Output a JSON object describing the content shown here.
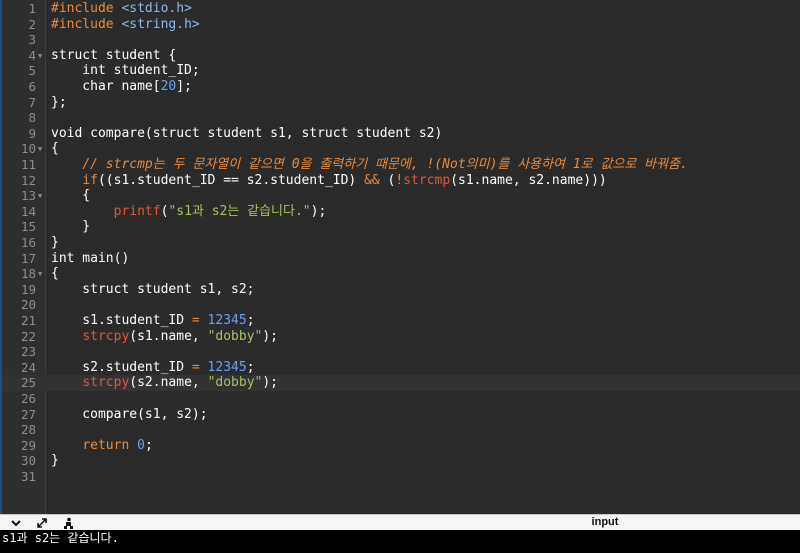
{
  "editor": {
    "active_line": 25,
    "lines": [
      {
        "n": "1",
        "fold": false,
        "segs": [
          {
            "c": "t-pre",
            "t": "#include "
          },
          {
            "c": "t-inc",
            "t": "<stdio.h>"
          }
        ]
      },
      {
        "n": "2",
        "fold": false,
        "segs": [
          {
            "c": "t-pre",
            "t": "#include "
          },
          {
            "c": "t-inc",
            "t": "<string.h>"
          }
        ]
      },
      {
        "n": "3",
        "fold": false,
        "segs": []
      },
      {
        "n": "4",
        "fold": true,
        "segs": [
          {
            "c": "",
            "t": "struct student {"
          }
        ]
      },
      {
        "n": "5",
        "fold": false,
        "segs": [
          {
            "c": "",
            "t": "    int student_ID;"
          }
        ]
      },
      {
        "n": "6",
        "fold": false,
        "segs": [
          {
            "c": "",
            "t": "    char name["
          },
          {
            "c": "t-num",
            "t": "20"
          },
          {
            "c": "",
            "t": "];"
          }
        ]
      },
      {
        "n": "7",
        "fold": false,
        "segs": [
          {
            "c": "",
            "t": "};"
          }
        ]
      },
      {
        "n": "8",
        "fold": false,
        "segs": []
      },
      {
        "n": "9",
        "fold": false,
        "segs": [
          {
            "c": "",
            "t": "void compare(struct student s1, struct student s2)"
          }
        ]
      },
      {
        "n": "10",
        "fold": true,
        "segs": [
          {
            "c": "",
            "t": "{"
          }
        ]
      },
      {
        "n": "11",
        "fold": false,
        "segs": [
          {
            "c": "",
            "t": "    "
          },
          {
            "c": "t-com",
            "t": "// strcmp는 두 문자열이 같으면 0을 출력하기 때문에, !(Not의미)를 사용하여 1로 값으로 바꿔줌."
          }
        ]
      },
      {
        "n": "12",
        "fold": false,
        "segs": [
          {
            "c": "",
            "t": "    "
          },
          {
            "c": "t-kw",
            "t": "if"
          },
          {
            "c": "",
            "t": "((s1.student_ID == s2.student_ID) "
          },
          {
            "c": "t-op",
            "t": "&&"
          },
          {
            "c": "",
            "t": " ("
          },
          {
            "c": "t-op",
            "t": "!"
          },
          {
            "c": "t-fn",
            "t": "strcmp"
          },
          {
            "c": "",
            "t": "(s1.name, s2.name)))"
          }
        ]
      },
      {
        "n": "13",
        "fold": true,
        "segs": [
          {
            "c": "",
            "t": "    {"
          }
        ]
      },
      {
        "n": "14",
        "fold": false,
        "segs": [
          {
            "c": "",
            "t": "        "
          },
          {
            "c": "t-fn",
            "t": "printf"
          },
          {
            "c": "",
            "t": "("
          },
          {
            "c": "t-str",
            "t": "\"s1과 s2는 같습니다.\""
          },
          {
            "c": "",
            "t": ");"
          }
        ]
      },
      {
        "n": "15",
        "fold": false,
        "segs": [
          {
            "c": "",
            "t": "    }"
          }
        ]
      },
      {
        "n": "16",
        "fold": false,
        "segs": [
          {
            "c": "",
            "t": "}"
          }
        ]
      },
      {
        "n": "17",
        "fold": false,
        "segs": [
          {
            "c": "",
            "t": "int main()"
          }
        ]
      },
      {
        "n": "18",
        "fold": true,
        "segs": [
          {
            "c": "",
            "t": "{"
          }
        ]
      },
      {
        "n": "19",
        "fold": false,
        "segs": [
          {
            "c": "",
            "t": "    struct student s1, s2;"
          }
        ]
      },
      {
        "n": "20",
        "fold": false,
        "segs": []
      },
      {
        "n": "21",
        "fold": false,
        "segs": [
          {
            "c": "",
            "t": "    s1.student_ID "
          },
          {
            "c": "t-op",
            "t": "="
          },
          {
            "c": "",
            "t": " "
          },
          {
            "c": "t-num",
            "t": "12345"
          },
          {
            "c": "",
            "t": ";"
          }
        ]
      },
      {
        "n": "22",
        "fold": false,
        "segs": [
          {
            "c": "",
            "t": "    "
          },
          {
            "c": "t-fn",
            "t": "strcpy"
          },
          {
            "c": "",
            "t": "(s1.name, "
          },
          {
            "c": "t-str",
            "t": "\"dobby\""
          },
          {
            "c": "",
            "t": ");"
          }
        ]
      },
      {
        "n": "23",
        "fold": false,
        "segs": []
      },
      {
        "n": "24",
        "fold": false,
        "segs": [
          {
            "c": "",
            "t": "    s2.student_ID "
          },
          {
            "c": "t-op",
            "t": "="
          },
          {
            "c": "",
            "t": " "
          },
          {
            "c": "t-num",
            "t": "12345"
          },
          {
            "c": "",
            "t": ";"
          }
        ]
      },
      {
        "n": "25",
        "fold": false,
        "segs": [
          {
            "c": "",
            "t": "    "
          },
          {
            "c": "t-fn",
            "t": "strcpy"
          },
          {
            "c": "",
            "t": "(s2.name, "
          },
          {
            "c": "t-str",
            "t": "\"dobby\""
          },
          {
            "c": "",
            "t": ");"
          }
        ]
      },
      {
        "n": "26",
        "fold": false,
        "segs": []
      },
      {
        "n": "27",
        "fold": false,
        "segs": [
          {
            "c": "",
            "t": "    compare(s1, s2);"
          }
        ]
      },
      {
        "n": "28",
        "fold": false,
        "segs": []
      },
      {
        "n": "29",
        "fold": false,
        "segs": [
          {
            "c": "",
            "t": "    "
          },
          {
            "c": "t-kw",
            "t": "return"
          },
          {
            "c": "",
            "t": " "
          },
          {
            "c": "t-num",
            "t": "0"
          },
          {
            "c": "",
            "t": ";"
          }
        ]
      },
      {
        "n": "30",
        "fold": false,
        "segs": [
          {
            "c": "",
            "t": "}"
          }
        ]
      },
      {
        "n": "31",
        "fold": false,
        "segs": []
      }
    ]
  },
  "toolbar": {
    "collapse_icon": "chevron-down-icon",
    "expand_icon": "expand-arrows-icon",
    "run_icon": "run-person-icon",
    "input_label": "input"
  },
  "console": {
    "output": "s1과 s2는 같습니다."
  },
  "colors": {
    "background": "#2b2b2b",
    "gutter": "#2f2f2f",
    "keyword": "#e8893c",
    "number": "#6aa0e8",
    "string": "#a5c25c",
    "function": "#e0553a"
  }
}
